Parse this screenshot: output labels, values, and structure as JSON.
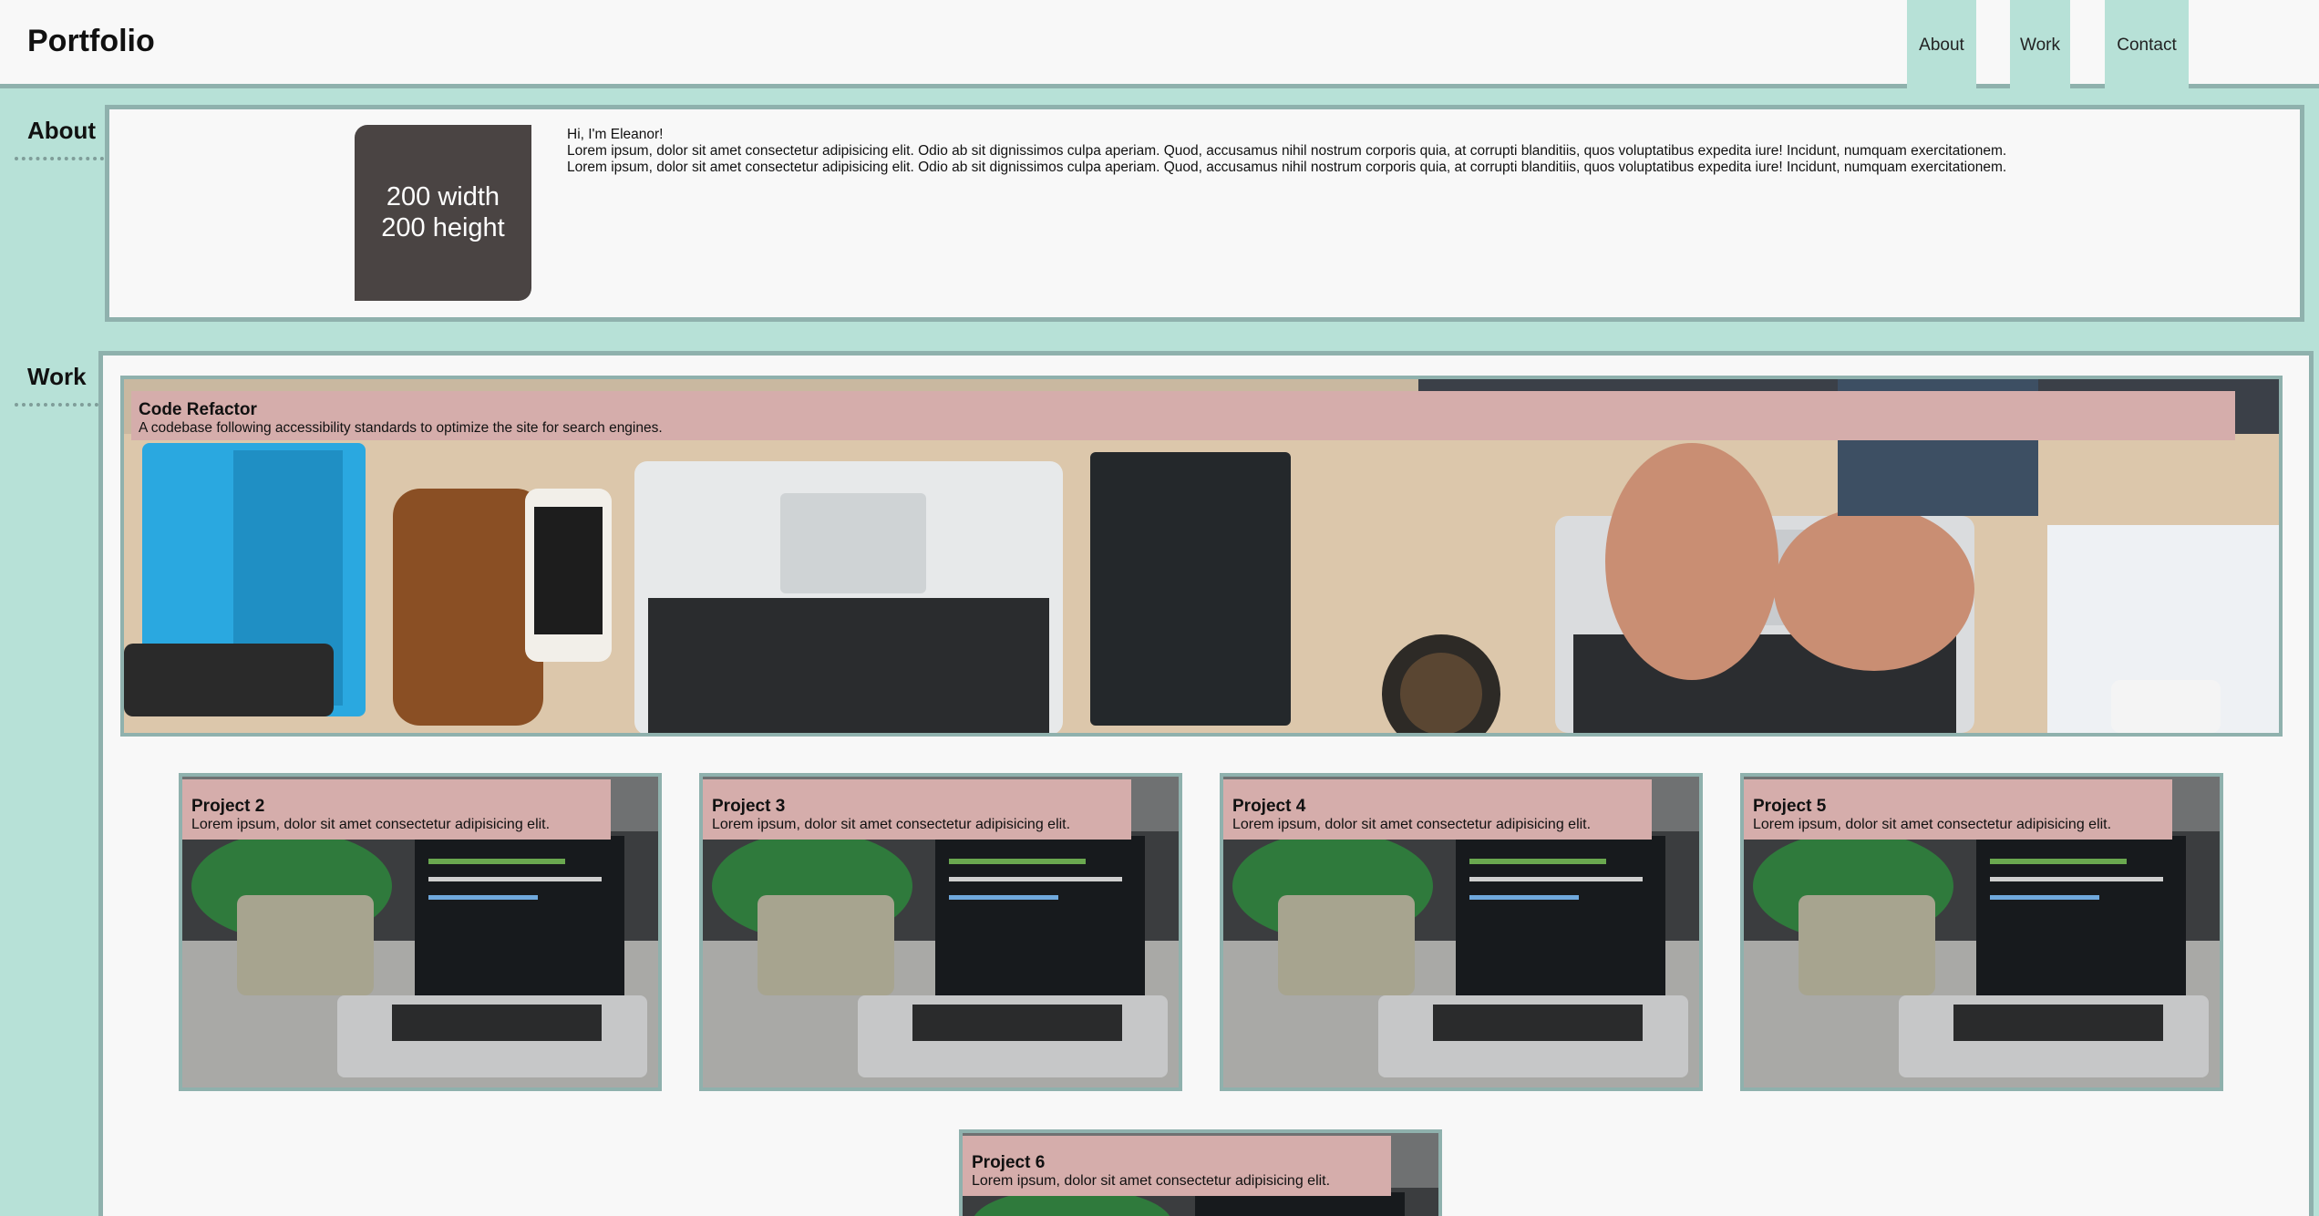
{
  "header": {
    "logo": "Portfolio",
    "nav": [
      {
        "label": "About"
      },
      {
        "label": "Work"
      },
      {
        "label": "Contact"
      }
    ]
  },
  "about": {
    "heading": "About",
    "placeholder_line1": "200 width",
    "placeholder_line2": "200 height",
    "greeting": "Hi, I'm Eleanor!",
    "paragraph1": "Lorem ipsum, dolor sit amet consectetur adipisicing elit. Odio ab sit dignissimos culpa aperiam. Quod, accusamus nihil nostrum corporis quia, at corrupti blanditiis, quos voluptatibus expedita iure! Incidunt, numquam exercitationem.",
    "paragraph2": "Lorem ipsum, dolor sit amet consectetur adipisicing elit. Odio ab sit dignissimos culpa aperiam. Quod, accusamus nihil nostrum corporis quia, at corrupti blanditiis, quos voluptatibus expedita iure! Incidunt, numquam exercitationem."
  },
  "work": {
    "heading": "Work",
    "featured": {
      "title": "Code Refactor",
      "description": "A codebase following accessibility standards to optimize the site for search engines."
    },
    "projects": [
      {
        "title": "Project 2",
        "description": "Lorem ipsum, dolor sit amet consectetur adipisicing elit."
      },
      {
        "title": "Project 3",
        "description": "Lorem ipsum, dolor sit amet consectetur adipisicing elit."
      },
      {
        "title": "Project 4",
        "description": "Lorem ipsum, dolor sit amet consectetur adipisicing elit."
      },
      {
        "title": "Project 5",
        "description": "Lorem ipsum, dolor sit amet consectetur adipisicing elit."
      },
      {
        "title": "Project 6",
        "description": "Lorem ipsum, dolor sit amet consectetur adipisicing elit."
      }
    ]
  },
  "colors": {
    "accent_mint": "#b7e1d7",
    "border_teal": "#8fb1ad",
    "caption_pink": "#d5adab",
    "placeholder_dark": "#4a4443",
    "page_bg": "#f8f8f8"
  }
}
